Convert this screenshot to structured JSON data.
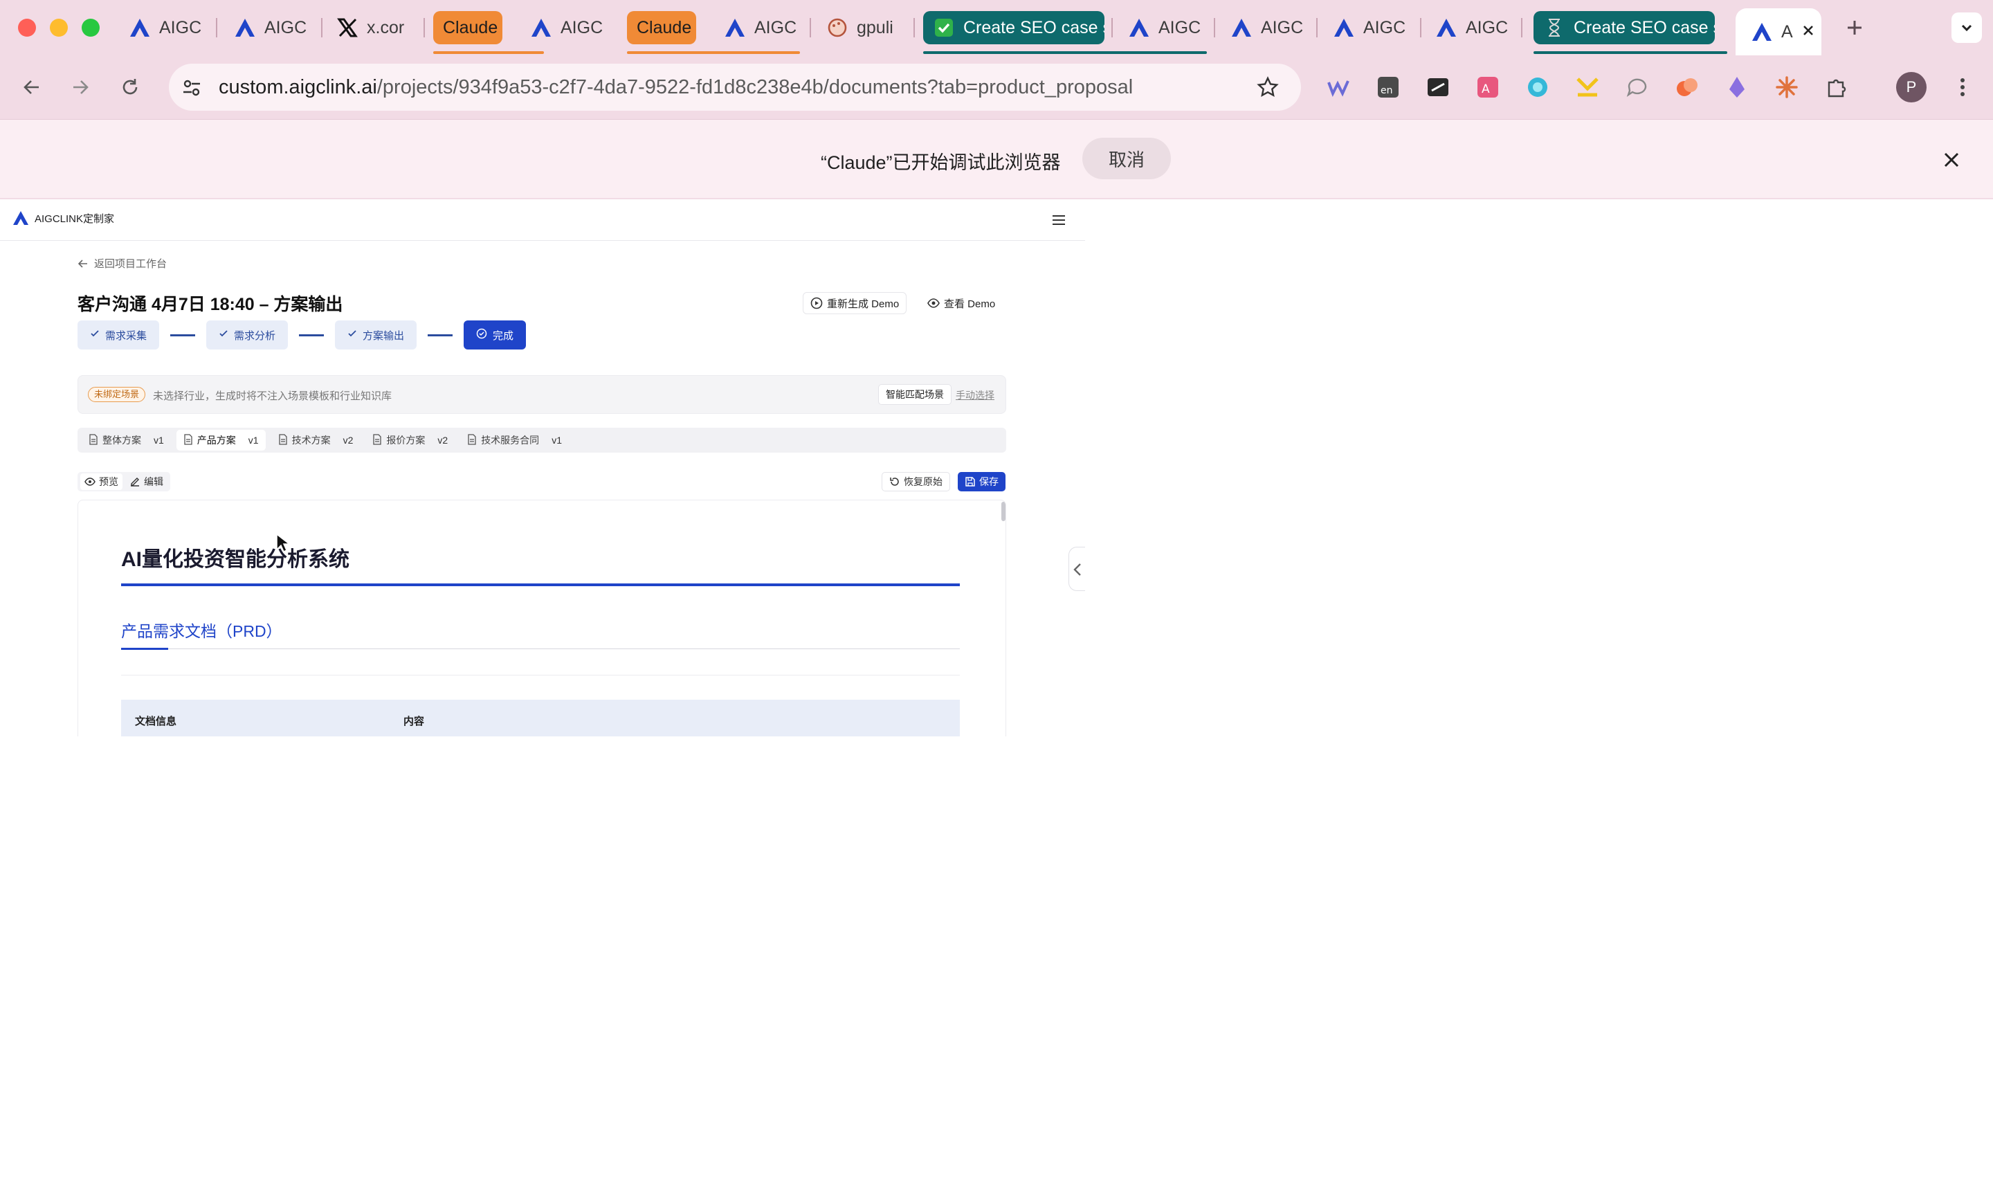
{
  "browser": {
    "tabs": [
      {
        "title": "AIGC",
        "icon": "aigc-logo-icon"
      },
      {
        "title": "AIGC",
        "icon": "aigc-logo-icon"
      },
      {
        "title": "x.cor",
        "icon": "x-logo-icon"
      },
      {
        "title": "Claude",
        "icon": "none"
      },
      {
        "title": "AIGC",
        "icon": "aigc-logo-icon"
      },
      {
        "title": "Claude",
        "icon": "none"
      },
      {
        "title": "AIGC",
        "icon": "aigc-logo-icon"
      },
      {
        "title": "gpuli",
        "icon": "palette-icon"
      },
      {
        "title": "Create SEO case s",
        "icon": "check-emoji-icon"
      },
      {
        "title": "AIGC",
        "icon": "aigc-logo-icon"
      },
      {
        "title": "AIGC",
        "icon": "aigc-logo-icon"
      },
      {
        "title": "AIGC",
        "icon": "aigc-logo-icon"
      },
      {
        "title": "AIGC",
        "icon": "aigc-logo-icon"
      },
      {
        "title": "Create SEO case s",
        "icon": "hourglass-icon"
      },
      {
        "title": "A",
        "icon": "aigc-logo-icon"
      }
    ],
    "url_host": "custom.aigclink.ai",
    "url_path": "/projects/934f9a53-c2f7-4da7-9522-fd1d8c238e4b/documents?tab=product_proposal",
    "avatar_letter": "P",
    "infobar": {
      "message": "“Claude”已开始调试此浏览器",
      "cancel_label": "取消"
    },
    "colors": {
      "chrome_bg": "#f2dbe5",
      "claude_tab": "#f08a36",
      "seo_tab": "#0e6a6c"
    }
  },
  "app": {
    "brand": "AIGCLINK定制家",
    "back_label": "返回项目工作台",
    "page_title": "客户沟通 4月7日 18:40 – 方案输出",
    "regenerate_label": "重新生成 Demo",
    "view_demo_label": "查看 Demo",
    "steps": [
      {
        "label": "需求采集",
        "state": "done"
      },
      {
        "label": "需求分析",
        "state": "done"
      },
      {
        "label": "方案输出",
        "state": "done"
      },
      {
        "label": "完成",
        "state": "current"
      }
    ],
    "scene": {
      "badge": "未绑定场景",
      "text": "未选择行业，生成时将不注入场景模板和行业知识库",
      "smart_label": "智能匹配场景",
      "manual_label": "手动选择"
    },
    "doc_tabs": [
      {
        "label": "整体方案",
        "version": "v1",
        "active": false
      },
      {
        "label": "产品方案",
        "version": "v1",
        "active": true
      },
      {
        "label": "技术方案",
        "version": "v2",
        "active": false
      },
      {
        "label": "报价方案",
        "version": "v2",
        "active": false
      },
      {
        "label": "技术服务合同",
        "version": "v1",
        "active": false
      }
    ],
    "view_modes": {
      "preview": "预览",
      "edit": "编辑"
    },
    "restore_label": "恢复原始",
    "save_label": "保存",
    "document": {
      "title": "AI量化投资智能分析系统",
      "subtitle": "产品需求文档（PRD）",
      "table_headers": [
        "文档信息",
        "内容"
      ]
    },
    "accent_color": "#1f44c9"
  }
}
